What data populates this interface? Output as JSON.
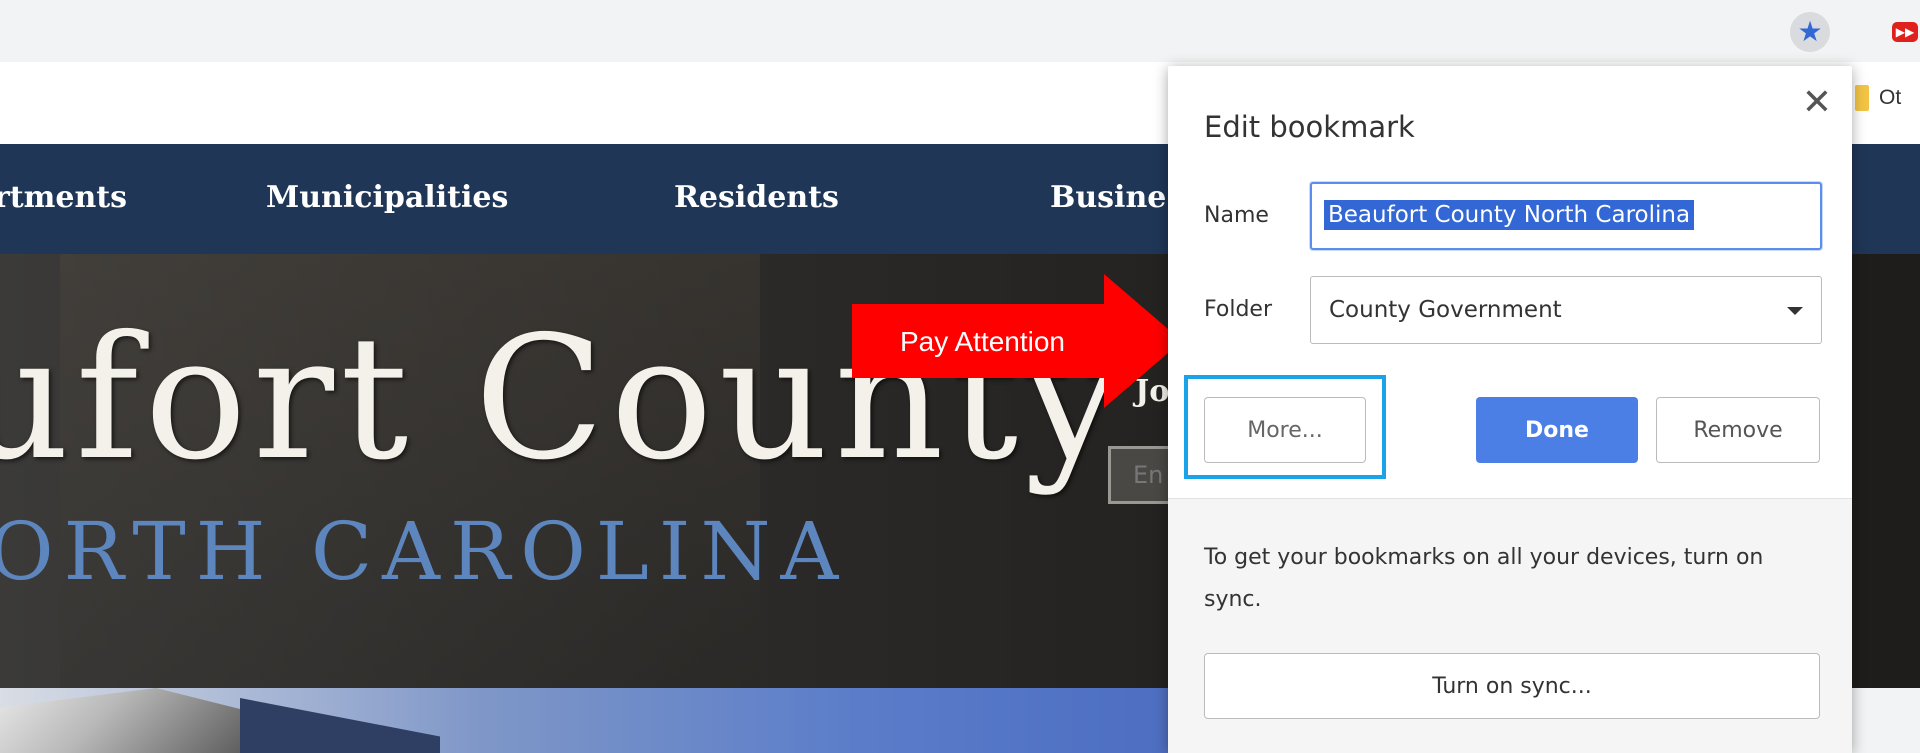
{
  "browser": {
    "bookmark_star_icon": "star-icon",
    "extension_icon": "extension-icon",
    "other_bookmarks_label": "Ot"
  },
  "site_nav": {
    "items": [
      "rtments",
      "Municipalities",
      "Residents",
      "Busine"
    ]
  },
  "hero": {
    "title": "ufort County",
    "subtitle": "ORTH CAROLINA",
    "join_label": "Jo",
    "input_placeholder": "En"
  },
  "annotation": {
    "label": "Pay Attention",
    "arrow_color": "#ff0000",
    "highlight_color": "#1aa3e8"
  },
  "popup": {
    "title": "Edit bookmark",
    "close_icon": "close-icon",
    "name_label": "Name",
    "name_value": "Beaufort County North Carolina",
    "folder_label": "Folder",
    "folder_value": "County Government",
    "more_label": "More...",
    "done_label": "Done",
    "remove_label": "Remove",
    "sync_message": "To get your bookmarks on all your devices, turn on sync.",
    "sync_button_label": "Turn on sync..."
  },
  "colors": {
    "nav_bg": "#1f3657",
    "done_button": "#4c7fe6",
    "hero_subtitle": "#5d86bf"
  }
}
